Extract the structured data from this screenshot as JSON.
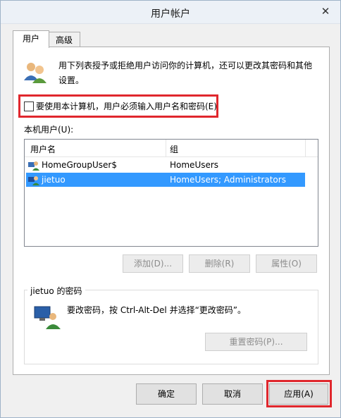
{
  "window": {
    "title": "用户帐户",
    "close_glyph": "✕"
  },
  "tabs": [
    {
      "label": "用户"
    },
    {
      "label": "高级"
    }
  ],
  "description": "用下列表授予或拒绝用户访问你的计算机，还可以更改其密码和其他设置。",
  "require_login": {
    "label": "要使用本计算机，用户必须输入用户名和密码(E)",
    "checked": false
  },
  "local_users": {
    "label": "本机用户(U):",
    "columns": [
      "用户名",
      "组"
    ],
    "rows": [
      {
        "name": "HomeGroupUser$",
        "group": "HomeUsers",
        "icon": "user-icon"
      },
      {
        "name": "jietuo",
        "group": "HomeUsers; Administrators",
        "icon": "user-icon",
        "selected": true
      }
    ]
  },
  "user_actions": {
    "add": "添加(D)...",
    "remove": "删除(R)",
    "properties": "属性(O)"
  },
  "password_group": {
    "title": "jietuo 的密码",
    "text": "要改密码，按 Ctrl-Alt-Del 并选择“更改密码”。",
    "reset_button": "重置密码(P)..."
  },
  "footer": {
    "ok": "确定",
    "cancel": "取消",
    "apply": "应用(A)"
  },
  "colors": {
    "highlight": "#e0272d",
    "selection": "#3399ff"
  }
}
